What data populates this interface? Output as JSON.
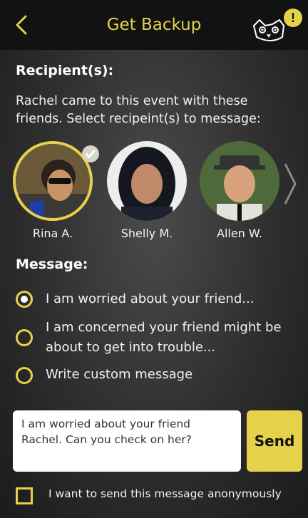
{
  "header": {
    "title": "Get Backup",
    "badge": "!"
  },
  "recipients": {
    "title": "Recipient(s):",
    "description": "Rachel came to this event with these friends. Select recipeint(s) to message:",
    "people": [
      {
        "name": "Rina A.",
        "selected": true
      },
      {
        "name": "Shelly M.",
        "selected": false
      },
      {
        "name": "Allen W.",
        "selected": false
      }
    ]
  },
  "message": {
    "title": "Message:",
    "options": [
      {
        "label": "I am worried about your friend...",
        "selected": true
      },
      {
        "label": "I am concerned your friend might be about to get into trouble...",
        "selected": false
      },
      {
        "label": "Write custom message",
        "selected": false
      }
    ],
    "text": "I am worried about your friend Rachel. Can you check on her?",
    "send_label": "Send"
  },
  "anonymous": {
    "label": "I want to send this message anonymously",
    "checked": false
  },
  "colors": {
    "accent": "#e6d24a",
    "header_bg": "#121212"
  }
}
